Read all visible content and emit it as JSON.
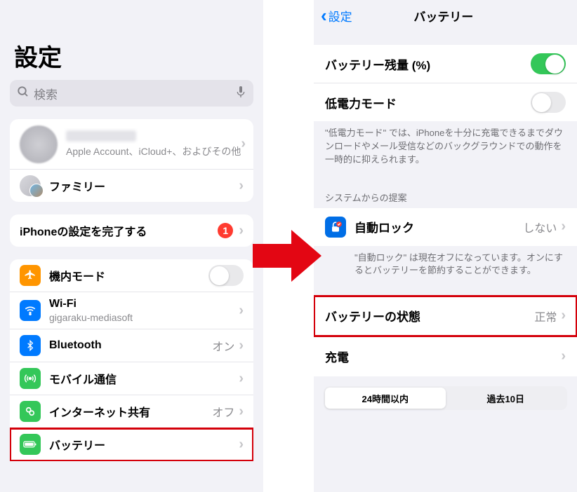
{
  "left": {
    "title": "設定",
    "search_placeholder": "検索",
    "account": {
      "sub": "Apple Account、iCloud+、およびその他"
    },
    "family_label": "ファミリー",
    "finish_setup": {
      "label": "iPhoneの設定を完了する",
      "badge": "1"
    },
    "items": {
      "airplane": "機内モード",
      "wifi": {
        "label": "Wi-Fi",
        "value": "gigaraku-mediasoft"
      },
      "bluetooth": {
        "label": "Bluetooth",
        "value": "オン"
      },
      "cellular": "モバイル通信",
      "hotspot": {
        "label": "インターネット共有",
        "value": "オフ"
      },
      "battery": "バッテリー"
    }
  },
  "right": {
    "back": "設定",
    "title": "バッテリー",
    "percent_label": "バッテリー残量 (%)",
    "lowpower_label": "低電力モード",
    "lowpower_footer": "\"低電力モード\" では、iPhoneを十分に充電できるまでダウンロードやメール受信などのバックグラウンドでの動作を一時的に抑えられます。",
    "suggestions_header": "システムからの提案",
    "autolock": {
      "label": "自動ロック",
      "value": "しない"
    },
    "autolock_footer": "\"自動ロック\" は現在オフになっています。オンにするとバッテリーを節約することができます。",
    "health": {
      "label": "バッテリーの状態",
      "value": "正常"
    },
    "charging_label": "充電",
    "seg": {
      "opt1": "24時間以内",
      "opt2": "過去10日"
    }
  }
}
